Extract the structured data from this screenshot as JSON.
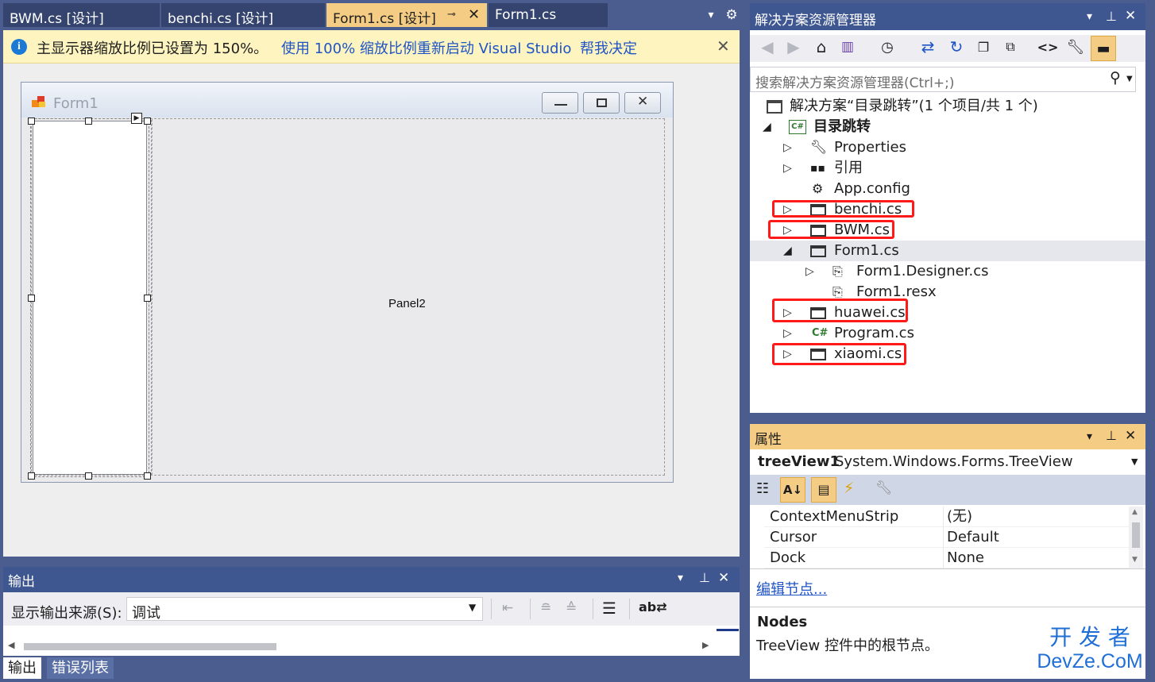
{
  "doc_tabs": [
    {
      "label": "BWM.cs [设计]",
      "active": false
    },
    {
      "label": "benchi.cs [设计]",
      "active": false
    },
    {
      "label": "Form1.cs [设计]",
      "active": true
    },
    {
      "label": "Form1.cs",
      "active": false
    }
  ],
  "infobar": {
    "message": "主显示器缩放比例已设置为 150%。",
    "restart_link": "使用 100% 缩放比例重新启动 Visual Studio",
    "decide_link": "帮我决定"
  },
  "designer": {
    "form_title": "Form1",
    "panel2_label": "Panel2"
  },
  "solution_explorer": {
    "title": "解决方案资源管理器",
    "search_placeholder": "搜索解决方案资源管理器(Ctrl+;)",
    "nodes": [
      {
        "label": "解决方案“目录跳转”(1 个项目/共 1 个)",
        "icon": "solution-icon"
      },
      {
        "label": "目录跳转",
        "icon": "csharp-project-icon",
        "bold": true
      },
      {
        "label": "Properties",
        "icon": "wrench-icon"
      },
      {
        "label": "引用",
        "icon": "references-icon"
      },
      {
        "label": "App.config",
        "icon": "config-file-icon"
      },
      {
        "label": "benchi.cs",
        "icon": "form-file-icon",
        "highlighted": true
      },
      {
        "label": "BWM.cs",
        "icon": "form-file-icon",
        "highlighted": true
      },
      {
        "label": "Form1.cs",
        "icon": "form-file-icon",
        "selected": true
      },
      {
        "label": "Form1.Designer.cs",
        "icon": "designer-file-icon"
      },
      {
        "label": "Form1.resx",
        "icon": "resx-file-icon"
      },
      {
        "label": "huawei.cs",
        "icon": "form-file-icon",
        "highlighted": true
      },
      {
        "label": "Program.cs",
        "icon": "csharp-file-icon"
      },
      {
        "label": "xiaomi.cs",
        "icon": "form-file-icon",
        "highlighted": true
      }
    ]
  },
  "properties": {
    "title": "属性",
    "object_name": "treeView1",
    "object_type": "System.Windows.Forms.TreeView",
    "rows": [
      {
        "name": "ContextMenuStrip",
        "value": "(无)"
      },
      {
        "name": "Cursor",
        "value": "Default"
      },
      {
        "name": "Dock",
        "value": "None"
      }
    ],
    "command_link": "编辑节点...",
    "desc_title": "Nodes",
    "desc_text": "TreeView 控件中的根节点。"
  },
  "output": {
    "title": "输出",
    "source_label": "显示输出来源(S):",
    "source_value": "调试"
  },
  "bottom_tabs": [
    "输出",
    "错误列表"
  ],
  "watermark": {
    "line1": "开 发 者",
    "line2": "DevZe.CoM"
  },
  "colors": {
    "chrome": "#4b5c8f",
    "tab_active": "#f5cc84",
    "infobar": "#fdf4bf",
    "link": "#1f54c7",
    "highlight_box": "#ff1a1a"
  }
}
